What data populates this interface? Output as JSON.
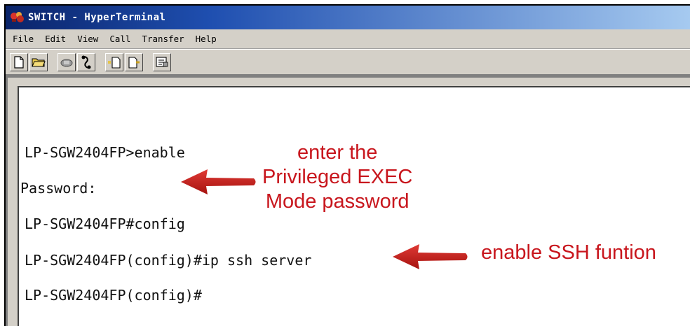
{
  "window": {
    "title": "SWITCH - HyperTerminal"
  },
  "menu": {
    "items": [
      "File",
      "Edit",
      "View",
      "Call",
      "Transfer",
      "Help"
    ]
  },
  "toolbar": {
    "icons": [
      "new-document-icon",
      "open-folder-icon",
      "phone-icon",
      "disconnect-icon",
      "send-file-icon",
      "receive-file-icon",
      "properties-icon"
    ]
  },
  "terminal": {
    "lines": [
      "LP-SGW2404FP>enable",
      "Password:",
      "LP-SGW2404FP#config",
      "LP-SGW2404FP(config)#ip ssh server",
      "LP-SGW2404FP(config)#"
    ]
  },
  "annotations": {
    "password_note": [
      "enter the",
      "Privileged EXEC",
      "Mode password"
    ],
    "ssh_note": "enable SSH funtion",
    "accent_color": "#c8161d"
  }
}
